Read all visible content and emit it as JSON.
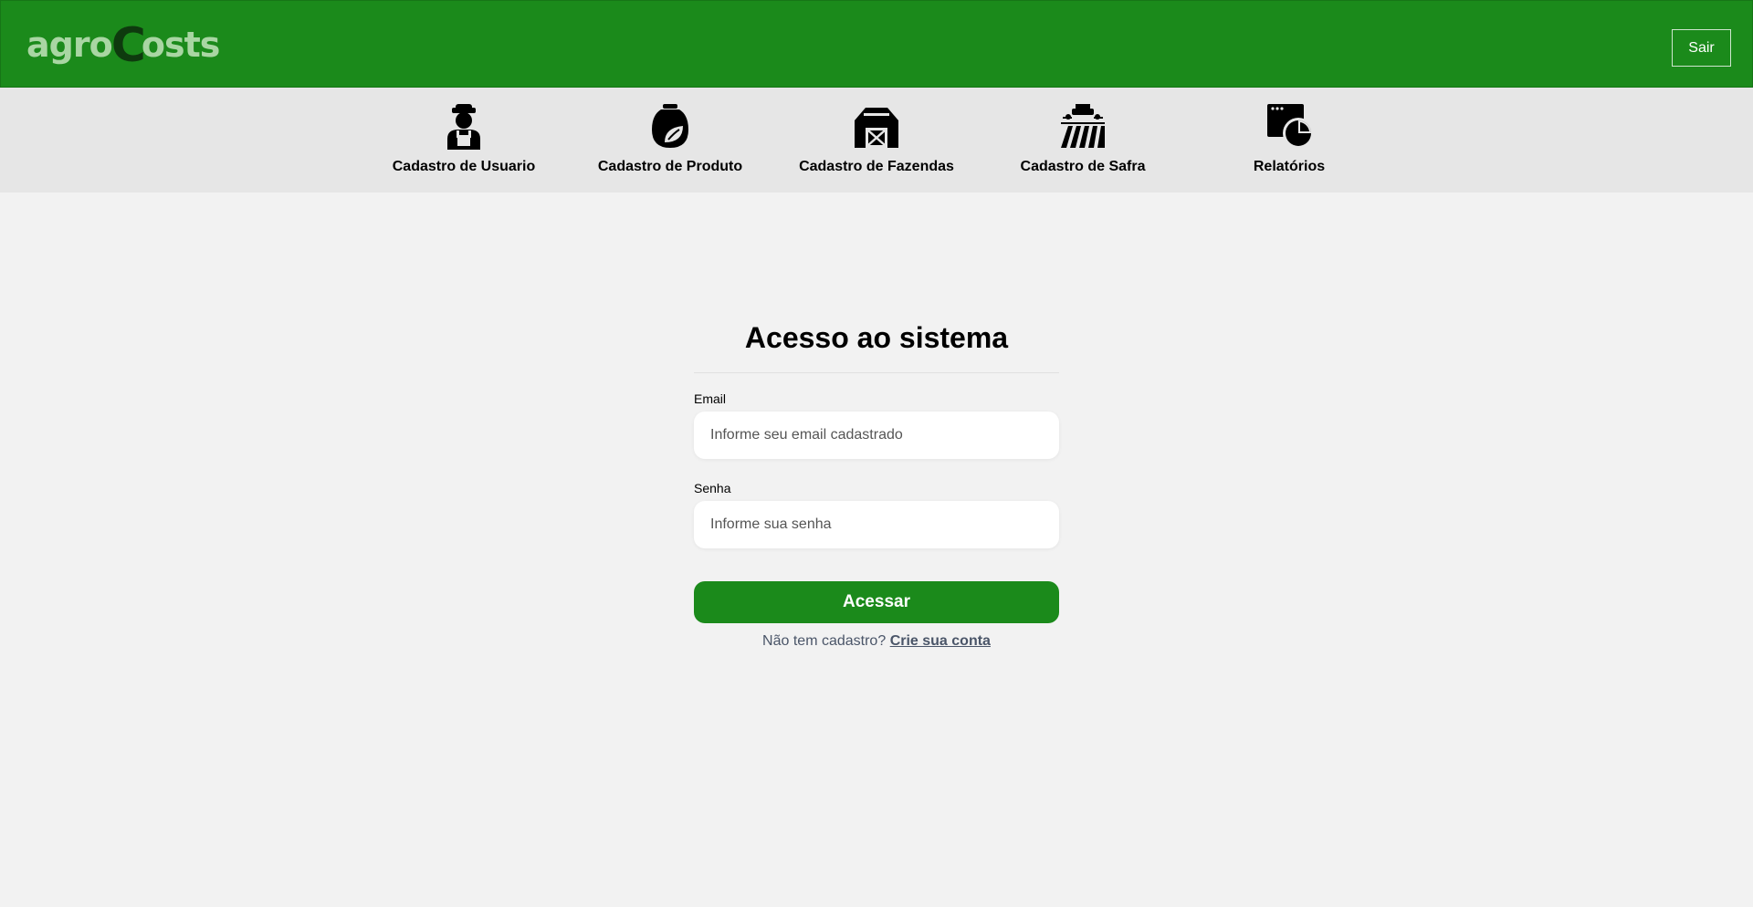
{
  "header": {
    "logo_prefix": "agro",
    "logo_c": "C",
    "logo_suffix": "osts",
    "logout_label": "Sair",
    "bg_color": "#1b8a1b"
  },
  "nav": {
    "items": [
      {
        "label": "Cadastro de Usuario",
        "icon": "farmer-icon"
      },
      {
        "label": "Cadastro de Produto",
        "icon": "fertilizer-bag-icon"
      },
      {
        "label": "Cadastro de Fazendas",
        "icon": "barn-icon"
      },
      {
        "label": "Cadastro de Safra",
        "icon": "tractor-field-icon"
      },
      {
        "label": "Relatórios",
        "icon": "report-chart-icon"
      }
    ]
  },
  "login": {
    "title": "Acesso ao sistema",
    "email_label": "Email",
    "email_placeholder": "Informe seu email cadastrado",
    "password_label": "Senha",
    "password_placeholder": "Informe sua senha",
    "submit_label": "Acessar",
    "signup_prompt": "Não tem cadastro?",
    "signup_link": "Crie sua conta"
  }
}
